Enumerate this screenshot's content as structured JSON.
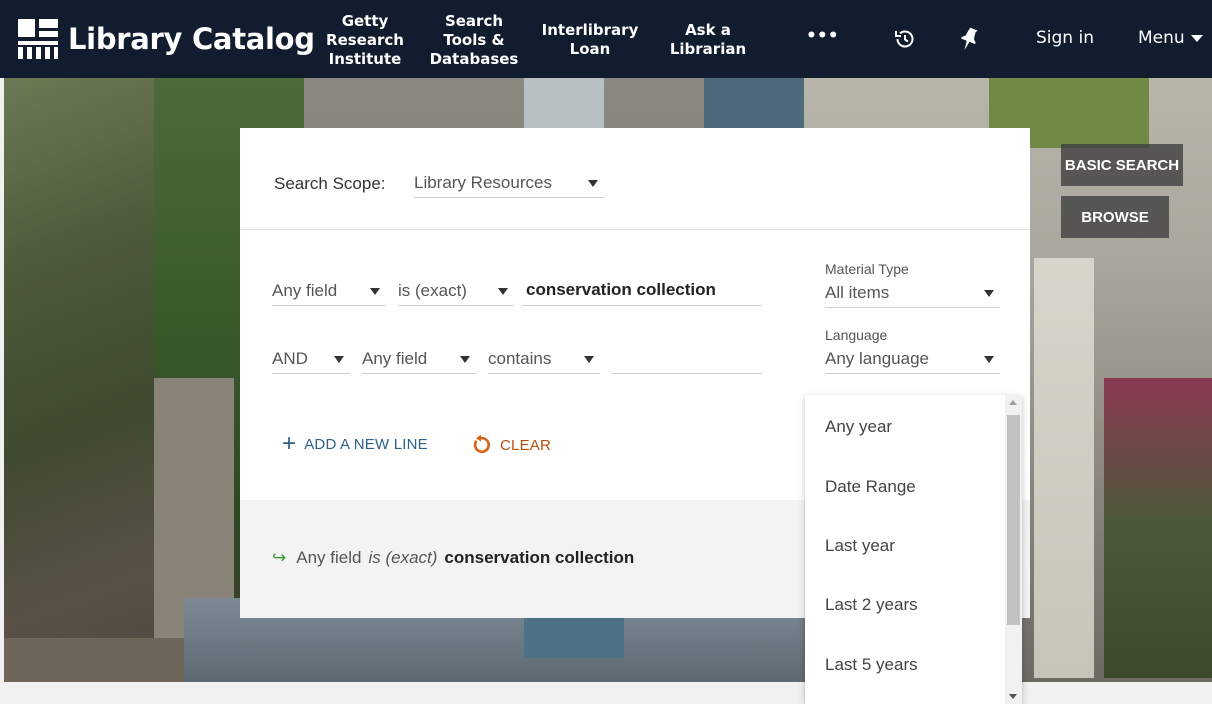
{
  "app": {
    "title": "Library Catalog"
  },
  "nav": {
    "links": [
      {
        "line1": "Getty",
        "line2": "Research",
        "line3": "Institute"
      },
      {
        "line1": "Search",
        "line2": "Tools &",
        "line3": "Databases"
      },
      {
        "line1": "Interlibrary",
        "line2": "Loan"
      },
      {
        "line1": "Ask a",
        "line2": "Librarian"
      }
    ],
    "more": "•••",
    "history_icon": "history-icon",
    "pin_icon": "pin-icon",
    "sign_in": "Sign in",
    "menu": "Menu"
  },
  "side": {
    "basic_search": "BASIC SEARCH",
    "browse": "BROWSE"
  },
  "search": {
    "scope_label": "Search Scope:",
    "scope_value": "Library Resources",
    "row1": {
      "field": "Any field",
      "operator": "is (exact)",
      "value": "conservation collection"
    },
    "row2": {
      "boolean": "AND",
      "field": "Any field",
      "operator": "contains",
      "value": ""
    },
    "material_type_label": "Material Type",
    "material_type_value": "All items",
    "language_label": "Language",
    "language_value": "Any language",
    "add_line": "ADD A NEW LINE",
    "clear": "CLEAR",
    "summary": {
      "field": "Any field",
      "operator": "is (exact)",
      "value": "conservation collection"
    }
  },
  "date_dropdown": {
    "options": [
      "Any year",
      "Date Range",
      "Last year",
      "Last 2 years",
      "Last 5 years"
    ]
  },
  "colors": {
    "navbar": "#111c2e",
    "accent_blue": "#2d5f87",
    "clear_orange": "#b5520f",
    "summary_arrow": "#3a9d3a"
  }
}
